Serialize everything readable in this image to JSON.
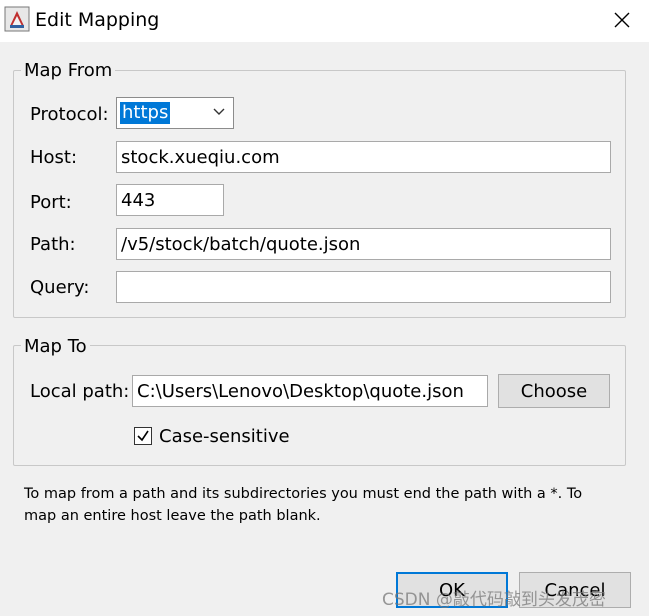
{
  "window": {
    "title": "Edit Mapping",
    "app_icon": "java-cup-icon",
    "close_icon": "close-icon"
  },
  "map_from": {
    "legend": "Map From",
    "protocol_label": "Protocol:",
    "protocol_value": "https",
    "host_label": "Host:",
    "host_value": "stock.xueqiu.com",
    "port_label": "Port:",
    "port_value": "443",
    "path_label": "Path:",
    "path_value": "/v5/stock/batch/quote.json",
    "query_label": "Query:",
    "query_value": ""
  },
  "map_to": {
    "legend": "Map To",
    "local_path_label": "Local path:",
    "local_path_value": "C:\\Users\\Lenovo\\Desktop\\quote.json",
    "choose_label": "Choose",
    "case_sensitive_label": "Case-sensitive",
    "case_sensitive_checked": true
  },
  "note": "To map from a path and its subdirectories you must end the path with a *. To map an entire host leave the path blank.",
  "buttons": {
    "ok": "OK",
    "cancel": "Cancel"
  },
  "watermark": "CSDN @敲代码敲到头发茂密"
}
